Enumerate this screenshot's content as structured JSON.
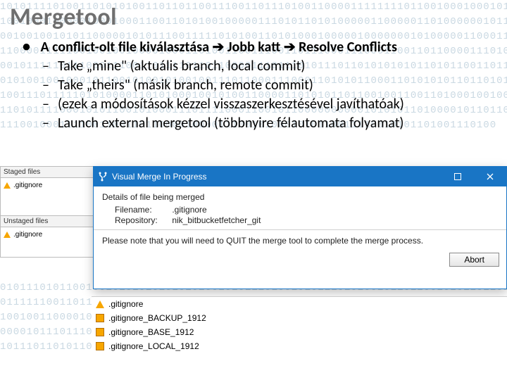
{
  "title": "Mergetool",
  "main_bullet": {
    "part1": "A conflict-olt file kiválasztása ",
    "part2": " Jobb katt ",
    "part3": " Resolve Conflicts"
  },
  "sub_items": [
    "Take „mine\" (aktuális branch, local commit)",
    "Take „theirs\" (másik branch, remote commit)",
    "(ezek a módosítások kézzel visszaszerkesztésével javíthatóak)",
    "Launch external mergetool (többnyire félautomata folyamat)"
  ],
  "panel_staged": {
    "header": "Staged files",
    "rows": [
      ".gitignore"
    ]
  },
  "panel_unstaged": {
    "header": "Unstaged files",
    "rows": [
      ".gitignore"
    ]
  },
  "dialog": {
    "title": "Visual Merge In Progress",
    "group_title": "Details of file being merged",
    "filename_label": "Filename:",
    "filename_value": ".gitignore",
    "repo_label": "Repository:",
    "repo_value": "nik_bitbucketfetcher_git",
    "note": "Please note that you will need to QUIT the merge tool to complete the merge process.",
    "abort_label": "Abort"
  },
  "conflict_list": [
    ".gitignore",
    ".gitignore_BACKUP_1912",
    ".gitignore_BASE_1912",
    ".gitignore_LOCAL_1912"
  ],
  "bg_binary": "101011110100110101010011011011001110011011101001100001111111101100100010001010\n100100010000010001000110011010100100000111010110101000001100000110100000010111\n001001001010110000010101110011111010100110101000100000100000001010000011000110\n110000111110010010010000100011010011001110011011100011100011001101100001110101\n001011111011100011100110111101101100001110111010111011010101010110101100110110\n010100100100010110010100101001001110110001110001101010110001101010101101101010\n100111011111010100001101010001001010011000011010101101100100110011010001001001\n110101111000101011001010001110111100011001011000000000010101011010000101101100\n111001000111100110011011000010000111001010001010110011110010101101001110100\n\n\n\n\n\n\n\n\n\n\n010111010110010010101010101010100101011101001010111010100101101100101011011010\n011111100110110001101100101001001011100110010001001101001010110001000101101010\n100100110000101100101010100001100010100010101001101010111010100101001000101011\n000010111011101010100000111010111110110011101010100010001010010010011011010111\n101110110101101101011110110100100101101001011001010010101110100101010001010111"
}
